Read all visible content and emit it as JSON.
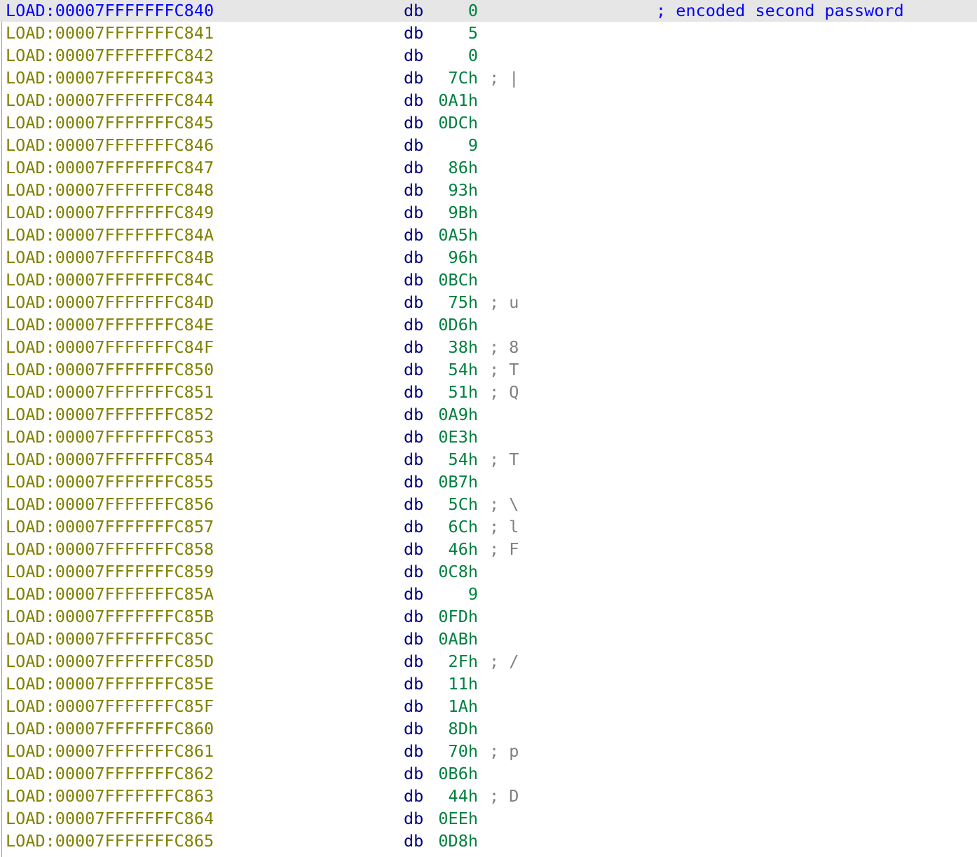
{
  "listing": {
    "mnemonic": "db",
    "rows": [
      {
        "addr": "LOAD:00007FFFFFFFC840",
        "value": "0",
        "comment": "; encoded second password",
        "current": true
      },
      {
        "addr": "LOAD:00007FFFFFFFC841",
        "value": "5",
        "comment": ""
      },
      {
        "addr": "LOAD:00007FFFFFFFC842",
        "value": "0",
        "comment": ""
      },
      {
        "addr": "LOAD:00007FFFFFFFC843",
        "value": "7Ch",
        "comment": "; |"
      },
      {
        "addr": "LOAD:00007FFFFFFFC844",
        "value": "0A1h",
        "comment": ""
      },
      {
        "addr": "LOAD:00007FFFFFFFC845",
        "value": "0DCh",
        "comment": ""
      },
      {
        "addr": "LOAD:00007FFFFFFFC846",
        "value": "9",
        "comment": ""
      },
      {
        "addr": "LOAD:00007FFFFFFFC847",
        "value": "86h",
        "comment": ""
      },
      {
        "addr": "LOAD:00007FFFFFFFC848",
        "value": "93h",
        "comment": ""
      },
      {
        "addr": "LOAD:00007FFFFFFFC849",
        "value": "9Bh",
        "comment": ""
      },
      {
        "addr": "LOAD:00007FFFFFFFC84A",
        "value": "0A5h",
        "comment": ""
      },
      {
        "addr": "LOAD:00007FFFFFFFC84B",
        "value": "96h",
        "comment": ""
      },
      {
        "addr": "LOAD:00007FFFFFFFC84C",
        "value": "0BCh",
        "comment": ""
      },
      {
        "addr": "LOAD:00007FFFFFFFC84D",
        "value": "75h",
        "comment": "; u"
      },
      {
        "addr": "LOAD:00007FFFFFFFC84E",
        "value": "0D6h",
        "comment": ""
      },
      {
        "addr": "LOAD:00007FFFFFFFC84F",
        "value": "38h",
        "comment": "; 8"
      },
      {
        "addr": "LOAD:00007FFFFFFFC850",
        "value": "54h",
        "comment": "; T"
      },
      {
        "addr": "LOAD:00007FFFFFFFC851",
        "value": "51h",
        "comment": "; Q"
      },
      {
        "addr": "LOAD:00007FFFFFFFC852",
        "value": "0A9h",
        "comment": ""
      },
      {
        "addr": "LOAD:00007FFFFFFFC853",
        "value": "0E3h",
        "comment": ""
      },
      {
        "addr": "LOAD:00007FFFFFFFC854",
        "value": "54h",
        "comment": "; T"
      },
      {
        "addr": "LOAD:00007FFFFFFFC855",
        "value": "0B7h",
        "comment": ""
      },
      {
        "addr": "LOAD:00007FFFFFFFC856",
        "value": "5Ch",
        "comment": "; \\"
      },
      {
        "addr": "LOAD:00007FFFFFFFC857",
        "value": "6Ch",
        "comment": "; l"
      },
      {
        "addr": "LOAD:00007FFFFFFFC858",
        "value": "46h",
        "comment": "; F"
      },
      {
        "addr": "LOAD:00007FFFFFFFC859",
        "value": "0C8h",
        "comment": ""
      },
      {
        "addr": "LOAD:00007FFFFFFFC85A",
        "value": "9",
        "comment": ""
      },
      {
        "addr": "LOAD:00007FFFFFFFC85B",
        "value": "0FDh",
        "comment": ""
      },
      {
        "addr": "LOAD:00007FFFFFFFC85C",
        "value": "0ABh",
        "comment": ""
      },
      {
        "addr": "LOAD:00007FFFFFFFC85D",
        "value": "2Fh",
        "comment": "; /"
      },
      {
        "addr": "LOAD:00007FFFFFFFC85E",
        "value": "11h",
        "comment": ""
      },
      {
        "addr": "LOAD:00007FFFFFFFC85F",
        "value": "1Ah",
        "comment": ""
      },
      {
        "addr": "LOAD:00007FFFFFFFC860",
        "value": "8Dh",
        "comment": ""
      },
      {
        "addr": "LOAD:00007FFFFFFFC861",
        "value": "70h",
        "comment": "; p"
      },
      {
        "addr": "LOAD:00007FFFFFFFC862",
        "value": "0B6h",
        "comment": ""
      },
      {
        "addr": "LOAD:00007FFFFFFFC863",
        "value": "44h",
        "comment": "; D"
      },
      {
        "addr": "LOAD:00007FFFFFFFC864",
        "value": "0EEh",
        "comment": ""
      },
      {
        "addr": "LOAD:00007FFFFFFFC865",
        "value": "0D8h",
        "comment": ""
      }
    ]
  },
  "colors": {
    "address": "#808000",
    "address_current": "#0000ff",
    "mnemonic": "#000080",
    "value": "#008040",
    "comment": "#808080",
    "comment_current": "#0000ff",
    "current_line_bg": "#e6e6e6"
  }
}
